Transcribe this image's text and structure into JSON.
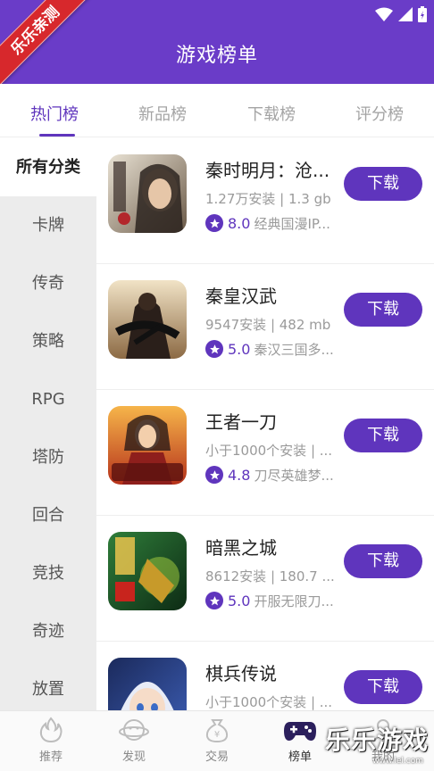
{
  "ribbon": {
    "text": "乐乐亲测"
  },
  "header": {
    "title": "游戏榜单"
  },
  "tabs": [
    {
      "label": "热门榜",
      "active": true
    },
    {
      "label": "新品榜",
      "active": false
    },
    {
      "label": "下载榜",
      "active": false
    },
    {
      "label": "评分榜",
      "active": false
    }
  ],
  "categories": [
    {
      "label": "所有分类",
      "active": true
    },
    {
      "label": "卡牌"
    },
    {
      "label": "传奇"
    },
    {
      "label": "策略"
    },
    {
      "label": "RPG"
    },
    {
      "label": "塔防"
    },
    {
      "label": "回合"
    },
    {
      "label": "竞技"
    },
    {
      "label": "奇迹"
    },
    {
      "label": "放置"
    }
  ],
  "games": [
    {
      "name": "秦时明月：沧...",
      "meta": "1.27万安装 | 1.3 gb",
      "score": "8.0",
      "tagline": "经典国漫IP...",
      "download_label": "下载",
      "icon": "qinshi-mingyue-icon"
    },
    {
      "name": "秦皇汉武",
      "meta": "9547安装 | 482 mb",
      "score": "5.0",
      "tagline": "秦汉三国多...",
      "download_label": "下载",
      "icon": "qinhuang-hanwu-icon"
    },
    {
      "name": "王者一刀",
      "meta": "小于1000个安装 | ...",
      "score": "4.8",
      "tagline": "刀尽英雄梦...",
      "download_label": "下载",
      "icon": "wangzhe-yidao-icon"
    },
    {
      "name": "暗黑之城",
      "meta": "8612安装 | 180.7 ...",
      "score": "5.0",
      "tagline": "开服无限刀...",
      "download_label": "下载",
      "icon": "anhei-zhicheng-icon"
    },
    {
      "name": "棋兵传说",
      "meta": "小于1000个安装 | ...",
      "score": "",
      "tagline": "",
      "download_label": "下载",
      "icon": "qibing-chuanshuo-icon"
    }
  ],
  "bottom_nav": [
    {
      "label": "推荐",
      "icon": "flame-icon"
    },
    {
      "label": "发现",
      "icon": "planet-icon"
    },
    {
      "label": "交易",
      "icon": "money-bag-icon"
    },
    {
      "label": "榜单",
      "icon": "gamepad-icon",
      "active": true
    },
    {
      "label": "我的",
      "icon": "person-icon"
    }
  ],
  "watermark": {
    "text": "乐乐游戏",
    "url": "www.lel.com"
  },
  "colors": {
    "primary": "#5f35bd",
    "header": "#6a3cc8",
    "ribbon": "#d7282c"
  }
}
